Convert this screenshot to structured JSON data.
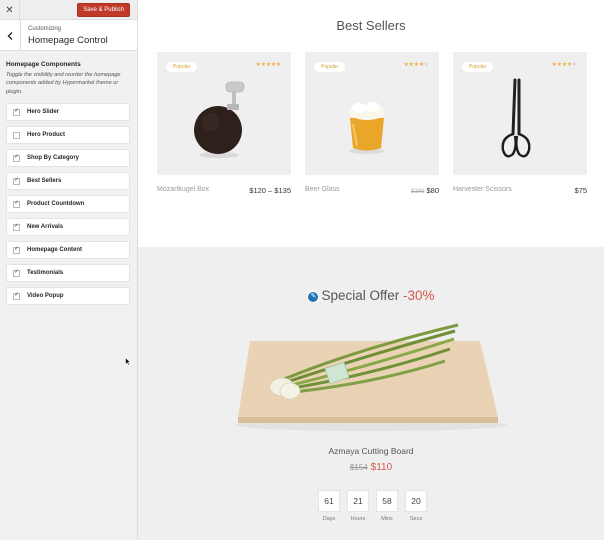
{
  "customizer": {
    "close_glyph": "✕",
    "save_label": "Save & Publish",
    "section_small": "Customizing",
    "section_title": "Homepage Control",
    "components_title": "Homepage Components",
    "components_desc": "Toggle the visibility and reorder the homepage components added by Hypermarket theme or plugin.",
    "items": [
      {
        "label": "Hero Slider",
        "checked": true,
        "mark": "✓"
      },
      {
        "label": "Hero Product",
        "checked": false,
        "mark": ""
      },
      {
        "label": "Shop By Category",
        "checked": true,
        "mark": "✓"
      },
      {
        "label": "Best Sellers",
        "checked": true,
        "mark": "✓"
      },
      {
        "label": "Product Countdown",
        "checked": true,
        "mark": "✓"
      },
      {
        "label": "New Arrivals",
        "checked": true,
        "mark": "✓"
      },
      {
        "label": "Homepage Content",
        "checked": true,
        "mark": "✓"
      },
      {
        "label": "Testimonials",
        "checked": true,
        "mark": "✓"
      },
      {
        "label": "Video Popup",
        "checked": true,
        "mark": "✓"
      }
    ]
  },
  "best_sellers": {
    "title": "Best Sellers",
    "products": [
      {
        "badge": "Popular",
        "rating": 5,
        "name": "Mozartkugel Box",
        "price": "$120 – $135",
        "old_price": ""
      },
      {
        "badge": "Popular",
        "rating": 4,
        "name": "Beer Glass",
        "price": "$80",
        "old_price": "$100"
      },
      {
        "badge": "Popular",
        "rating": 4,
        "name": "Harvester Scissors",
        "price": "$75",
        "old_price": ""
      }
    ]
  },
  "special_offer": {
    "edit_icon": "✎",
    "title": "Special Offer",
    "discount": "-30%",
    "product_name": "Azmaya Cutting Board",
    "old_price": "$154",
    "price": "$110",
    "countdown": [
      {
        "value": "61",
        "label": "Days"
      },
      {
        "value": "21",
        "label": "Hours"
      },
      {
        "value": "58",
        "label": "Mins"
      },
      {
        "value": "20",
        "label": "Secs"
      }
    ]
  },
  "colors": {
    "accent": "#c0392b",
    "sale": "#d7584b",
    "star": "#f0ad4e",
    "badge_text": "#d6a230",
    "edit": "#2271b1"
  }
}
